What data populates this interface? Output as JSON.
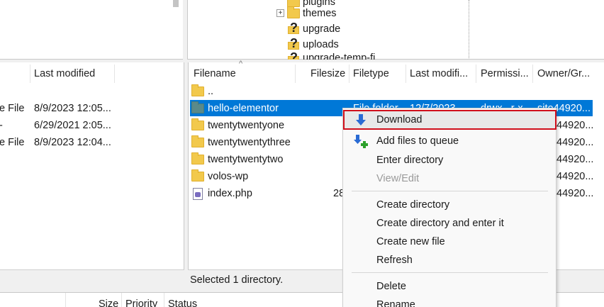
{
  "remote_tree": {
    "nodes": [
      {
        "label": "plugins",
        "icon": "folder-icon"
      },
      {
        "label": "themes",
        "icon": "folder-icon"
      },
      {
        "label": "upgrade",
        "icon": "unknown-folder-icon"
      },
      {
        "label": "uploads",
        "icon": "unknown-folder-icon"
      },
      {
        "label": "upgrade-temp-fi",
        "icon": "unknown-folder-icon"
      }
    ]
  },
  "local_list": {
    "columns": [
      "",
      "Last modified"
    ],
    "rows": [
      {
        "type": "e File",
        "modified": "8/9/2023 12:05..."
      },
      {
        "type": "-",
        "modified": "6/29/2021 2:05..."
      },
      {
        "type": "e File",
        "modified": "8/9/2023 12:04..."
      }
    ]
  },
  "remote_list": {
    "columns": [
      "Filename",
      "Filesize",
      "Filetype",
      "Last modifi...",
      "Permissi...",
      "Owner/Gr..."
    ],
    "rows": [
      {
        "name": "..",
        "icon": "folder-icon",
        "size": "",
        "owner": ""
      },
      {
        "name": "hello-elementor",
        "icon": "folder-icon",
        "selected": true,
        "filetype": "File folder",
        "modified": "12/7/2023",
        "perms": "drwx...r-x",
        "owner": "site44920..."
      },
      {
        "name": "twentytwentyone",
        "icon": "folder-icon",
        "size": "",
        "owner": "44920..."
      },
      {
        "name": "twentytwentythree",
        "icon": "folder-icon",
        "size": "",
        "owner": "44920..."
      },
      {
        "name": "twentytwentytwo",
        "icon": "folder-icon",
        "size": "",
        "owner": "44920..."
      },
      {
        "name": "volos-wp",
        "icon": "folder-icon",
        "size": "",
        "owner": "44920..."
      },
      {
        "name": "index.php",
        "icon": "php-file-icon",
        "size": "28",
        "owner": "44920..."
      }
    ],
    "status": "Selected 1 directory."
  },
  "queue": {
    "columns": [
      "Size",
      "Priority",
      "Status"
    ]
  },
  "context_menu": {
    "items": [
      {
        "label": "Download",
        "icon": "download-arrow-icon",
        "highlighted": true
      },
      {
        "label": "Add files to queue",
        "icon": "add-to-queue-icon"
      },
      {
        "label": "Enter directory"
      },
      {
        "label": "View/Edit",
        "disabled": true
      },
      {
        "label": "Create directory"
      },
      {
        "label": "Create directory and enter it"
      },
      {
        "label": "Create new file"
      },
      {
        "label": "Refresh"
      },
      {
        "label": "Delete"
      },
      {
        "label": "Rename"
      }
    ]
  },
  "colors": {
    "selection": "#0078d7",
    "highlight_outline": "#d0101c",
    "folder": "#f2c94c"
  }
}
